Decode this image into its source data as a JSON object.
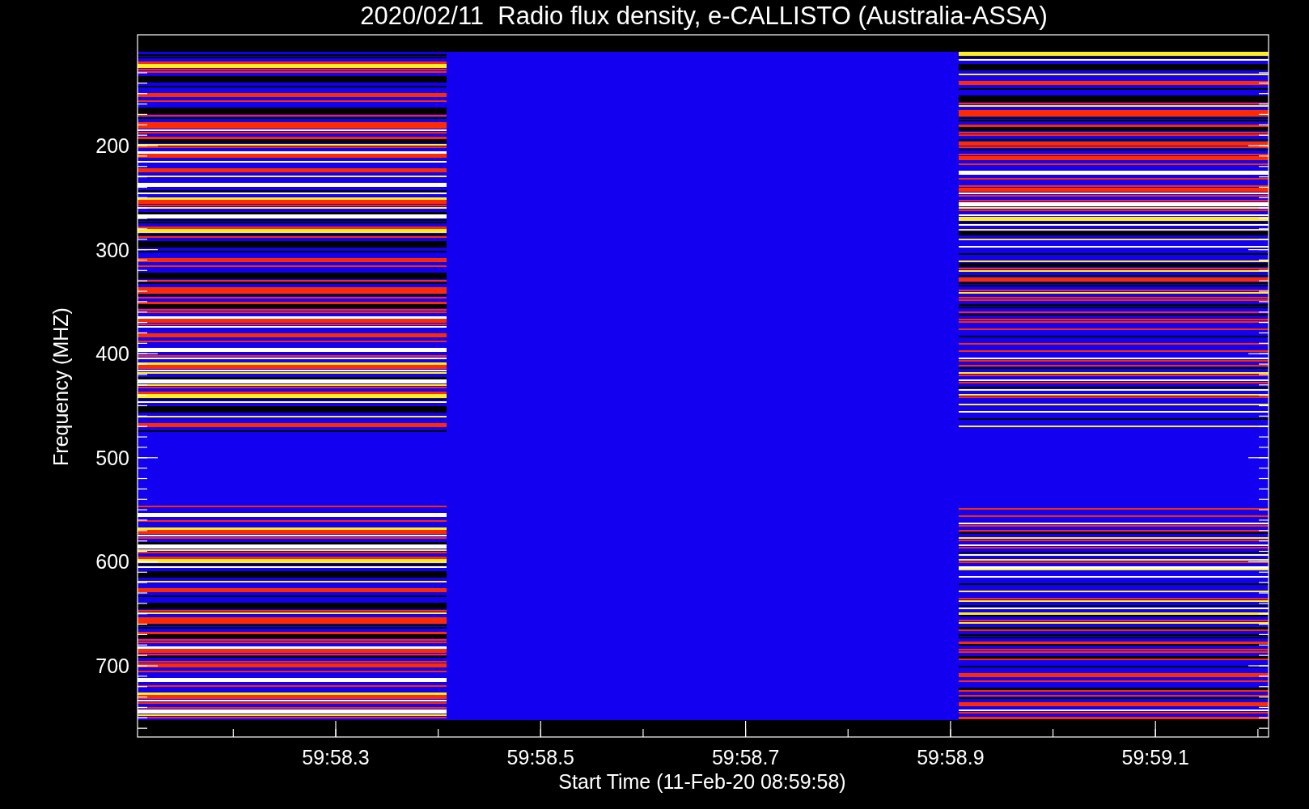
{
  "title": "2020/02/11  Radio flux density, e-CALLISTO (Australia-ASSA)",
  "y_axis": {
    "label": "Frequency (MHZ)",
    "ticks": [
      "200",
      "300",
      "400",
      "500",
      "600",
      "700"
    ]
  },
  "x_axis": {
    "label": "Start Time (11-Feb-20 08:59:58)",
    "ticks": [
      "59:58.3",
      "59:58.5",
      "59:58.7",
      "59:58.9",
      "59:59.1"
    ]
  }
}
